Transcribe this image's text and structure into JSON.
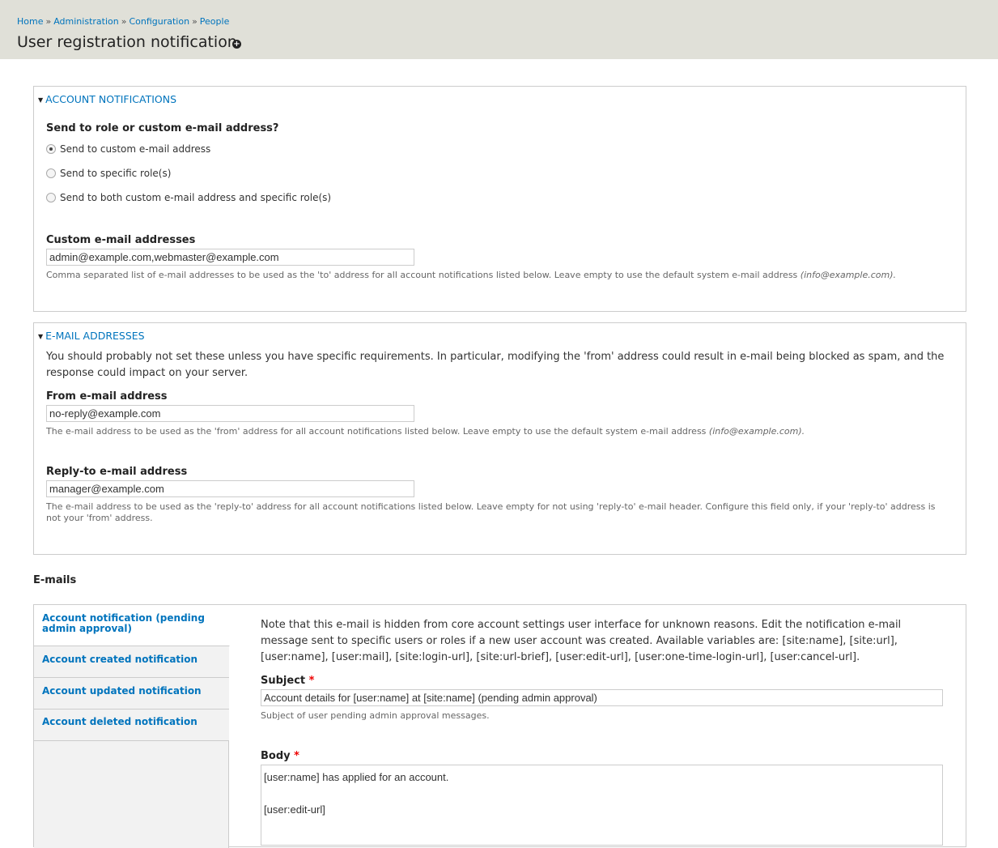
{
  "breadcrumb": [
    "Home",
    "Administration",
    "Configuration",
    "People"
  ],
  "breadcrumb_separator": "»",
  "page_title": "User registration notification",
  "account_notifications": {
    "legend": "ACCOUNT NOTIFICATIONS",
    "question": "Send to role or custom e-mail address?",
    "options": [
      {
        "label": "Send to custom e-mail address",
        "checked": true
      },
      {
        "label": "Send to specific role(s)",
        "checked": false
      },
      {
        "label": "Send to both custom e-mail address and specific role(s)",
        "checked": false
      }
    ],
    "custom_label": "Custom e-mail addresses",
    "custom_value": "admin@example.com,webmaster@example.com",
    "custom_desc": "Comma separated list of e-mail addresses to be used as the 'to' address for all account notifications listed below. Leave empty to use the default system e-mail address",
    "custom_desc_default": "(info@example.com)."
  },
  "email_addresses": {
    "legend": "E-MAIL ADDRESSES",
    "intro": "You should probably not set these unless you have specific requirements. In particular, modifying the 'from' address could result in e-mail being blocked as spam, and the response could impact on your server.",
    "from_label": "From e-mail address",
    "from_value": "no-reply@example.com",
    "from_desc": "The e-mail address to be used as the 'from' address for all account notifications listed below. Leave empty to use the default system e-mail address",
    "from_desc_default": "(info@example.com).",
    "reply_label": "Reply-to e-mail address",
    "reply_value": "manager@example.com",
    "reply_desc": "The e-mail address to be used as the 'reply-to' address for all account notifications listed below. Leave empty for not using 'reply-to' e-mail header. Configure this field only, if your 'reply-to' address is not your 'from' address."
  },
  "emails": {
    "heading": "E-mails",
    "tabs": [
      {
        "label": "Account notification (pending admin approval)",
        "active": true
      },
      {
        "label": "Account created notification",
        "active": false
      },
      {
        "label": "Account updated notification",
        "active": false
      },
      {
        "label": "Account deleted notification",
        "active": false
      }
    ],
    "note": "Note that this e-mail is hidden from core account settings user interface for unknown reasons. Edit the notification e-mail message sent to specific users or roles if a new user account was created. Available variables are: [site:name], [site:url], [user:name], [user:mail], [site:login-url], [site:url-brief], [user:edit-url], [user:one-time-login-url], [user:cancel-url].",
    "subject_label": "Subject",
    "required_marker": "*",
    "subject_value": "Account details for [user:name] at [site:name] (pending admin approval)",
    "subject_desc": "Subject of user pending admin approval messages.",
    "body_label": "Body",
    "body_value": "[user:name] has applied for an account.\n\n[user:edit-url]"
  }
}
